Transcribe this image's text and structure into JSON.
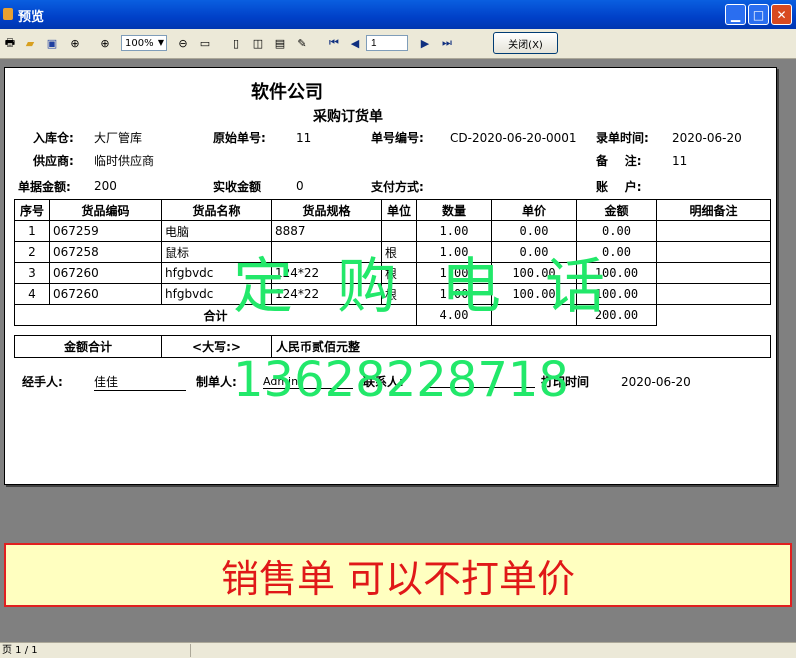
{
  "window": {
    "title": "预览"
  },
  "toolbar": {
    "zoom": "100%",
    "page": "1",
    "close_label": "关闭(X)"
  },
  "document": {
    "company": "软件公司",
    "form_title": "采购订货单",
    "fields": {
      "warehouse_label": "入库仓:",
      "warehouse_value": "大厂管库",
      "orig_no_label": "原始单号:",
      "orig_no_value": "11",
      "doc_no_label": "单号编号:",
      "doc_no_value": "CD-2020-06-20-0001",
      "entry_time_label": "录单时间:",
      "entry_time_value": "2020-06-20",
      "supplier_label": "供应商:",
      "supplier_value": "临时供应商",
      "remark_label": "备    注:",
      "remark_value": "11",
      "amount_label": "单据金额:",
      "amount_value": "200",
      "received_label": "实收金额",
      "received_value": "0",
      "payment_label": "支付方式:",
      "account_label": "账    户:"
    },
    "table": {
      "headers": [
        "序号",
        "货品编码",
        "货品名称",
        "货品规格",
        "单位",
        "数量",
        "单价",
        "金额",
        "明细备注"
      ],
      "rows": [
        [
          "1",
          "067259",
          "电脑",
          "8887",
          "",
          "1.00",
          "0.00",
          "0.00",
          ""
        ],
        [
          "2",
          "067258",
          "鼠标",
          "",
          "根",
          "1.00",
          "0.00",
          "0.00",
          ""
        ],
        [
          "3",
          "067260",
          "hfgbvdc",
          "124*22",
          "根",
          "1.00",
          "100.00",
          "100.00",
          ""
        ],
        [
          "4",
          "067260",
          "hfgbvdc",
          "124*22",
          "根",
          "1.00",
          "100.00",
          "100.00",
          ""
        ]
      ],
      "total_label": "合计",
      "total_qty": "4.00",
      "total_amount": "200.00"
    },
    "amount_summary": {
      "label": "金额合计",
      "upper_label": "<大写:>",
      "upper_value": "人民币贰佰元整"
    },
    "footer": {
      "handler_label": "经手人:",
      "handler_value": "佳佳",
      "maker_label": "制单人:",
      "maker_value": "Admin",
      "contact_label": "联系人:",
      "print_time_label": "打印时间",
      "print_time_value": "2020-06-20"
    }
  },
  "watermark": {
    "line1": "定购电话",
    "line2": "13628228718"
  },
  "banner": {
    "text": "销售单 可以不打单价"
  },
  "status": {
    "page_info": "页 1 / 1"
  }
}
